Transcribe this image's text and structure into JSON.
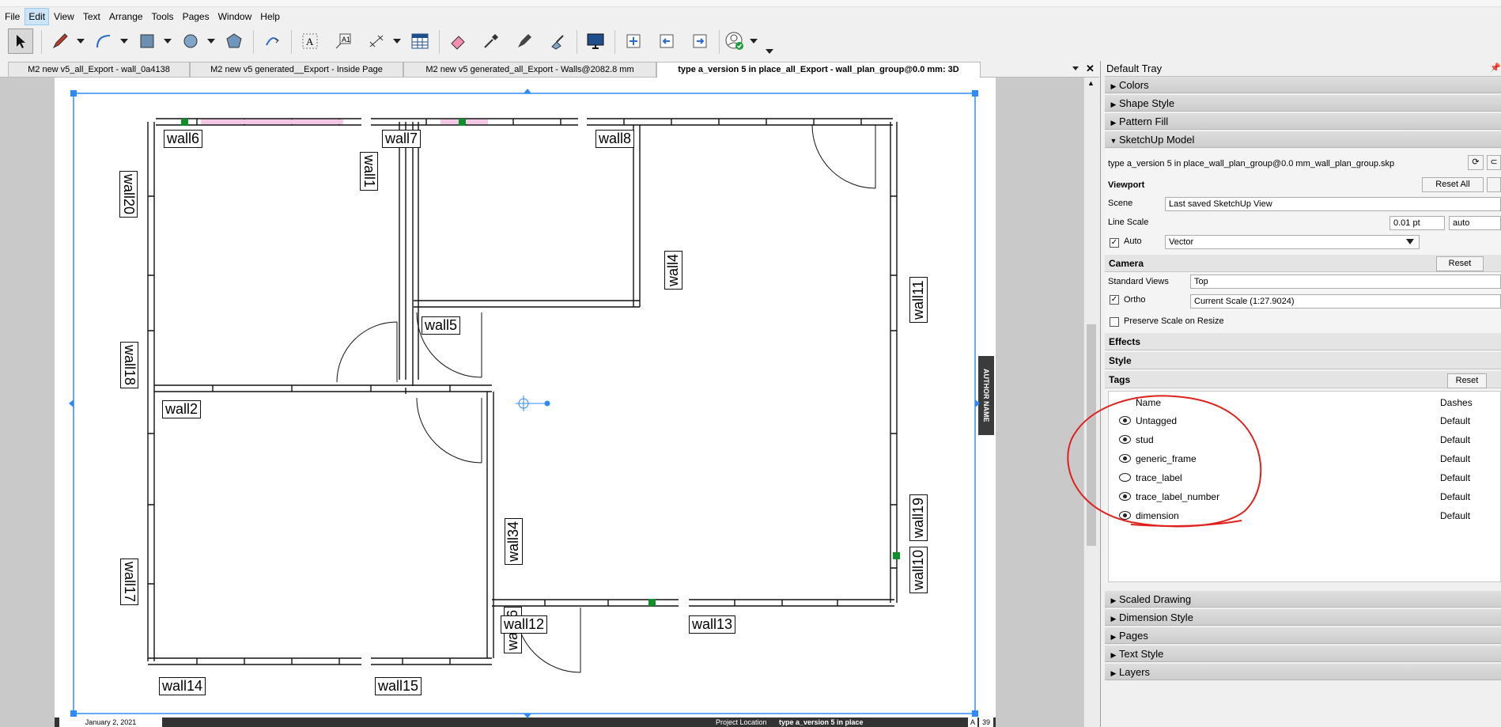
{
  "menubar": {
    "items": [
      "File",
      "Edit",
      "View",
      "Text",
      "Arrange",
      "Tools",
      "Pages",
      "Window",
      "Help"
    ],
    "active": "Edit"
  },
  "tabs": [
    {
      "label": "M2 new v5_all_Export - wall_0a4138",
      "active": false
    },
    {
      "label": "M2 new v5 generated__Export - Inside Page",
      "active": false
    },
    {
      "label": "M2 new v5 generated_all_Export - Walls@2082.8 mm",
      "active": false
    },
    {
      "label": "type a_version 5 in place_all_Export - wall_plan_group@0.0 mm: 3D",
      "active": true
    }
  ],
  "tabbar": {
    "dropdown_icon": "chevron-down-icon",
    "close_icon": "close-icon"
  },
  "canvas": {
    "labels": [
      "wall6",
      "wall7",
      "wall8",
      "wall1",
      "wall20",
      "wall4",
      "wall11",
      "wall5",
      "wall18",
      "wall2",
      "wall19",
      "wall34",
      "wall10",
      "wall17",
      "wall16",
      "wall12",
      "wall13",
      "wall14",
      "wall15"
    ],
    "author_tab": "AUTHOR NAME",
    "footer_date": "January 2, 2021",
    "footer_project": "Project Location",
    "footer_title": "type a_version 5 in place",
    "footer_num": "A",
    "footer_page": "39"
  },
  "tray": {
    "title": "Default Tray",
    "pin_icon": "pin-icon",
    "sections_top": [
      "Colors",
      "Shape Style",
      "Pattern Fill"
    ],
    "sketchup": {
      "title": "SketchUp Model",
      "file": "type a_version 5 in place_wall_plan_group@0.0 mm_wall_plan_group.skp",
      "viewport_label": "Viewport",
      "reset_all": "Reset All",
      "scene_label": "Scene",
      "scene_value": "Last saved SketchUp View",
      "line_scale_label": "Line Scale",
      "line_scale_value": "0.01 pt",
      "line_scale_auto": "auto",
      "auto_label": "Auto",
      "render_value": "Vector",
      "camera_label": "Camera",
      "camera_reset": "Reset",
      "standard_views_label": "Standard Views",
      "standard_views_value": "Top",
      "ortho_label": "Ortho",
      "ortho_value": "Current Scale (1:27.9024)",
      "preserve_label": "Preserve Scale on Resize",
      "effects_label": "Effects",
      "style_label": "Style",
      "tags_label": "Tags",
      "tags_reset": "Reset",
      "col_name": "Name",
      "col_dashes": "Dashes",
      "tags": [
        {
          "name": "Untagged",
          "dashes": "Default",
          "visible": true
        },
        {
          "name": "stud",
          "dashes": "Default",
          "visible": true
        },
        {
          "name": "generic_frame",
          "dashes": "Default",
          "visible": true
        },
        {
          "name": "trace_label",
          "dashes": "Default",
          "visible": false
        },
        {
          "name": "trace_label_number",
          "dashes": "Default",
          "visible": true
        },
        {
          "name": "dimension",
          "dashes": "Default",
          "visible": true
        }
      ]
    },
    "sections_bottom": [
      "Scaled Drawing",
      "Dimension Style",
      "Pages",
      "Text Style",
      "Layers"
    ]
  },
  "colors": {
    "selection": "#2e8bff",
    "annotation": "#e0201c",
    "green": "#0f8f2a",
    "pink": "#f4c7e4"
  }
}
